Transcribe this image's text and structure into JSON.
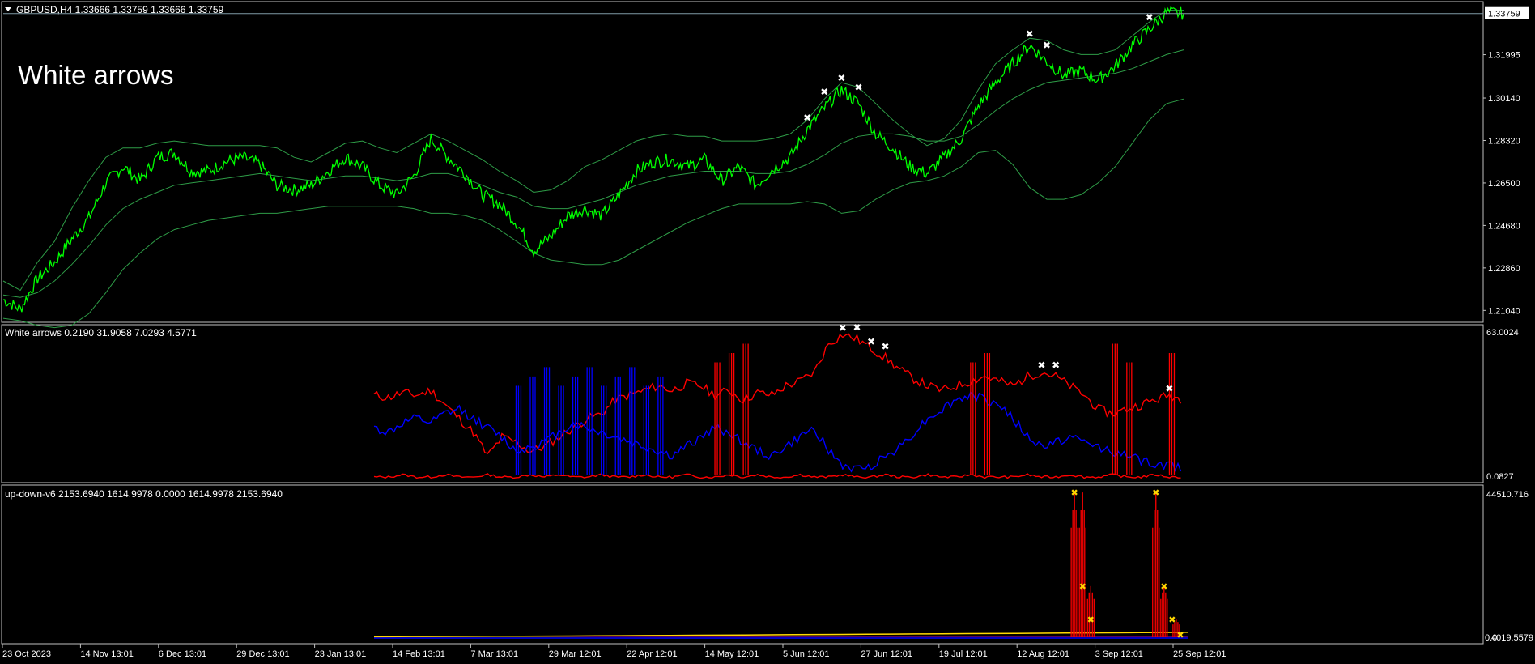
{
  "colors": {
    "background": "#000000",
    "frame": "#c0c0c0",
    "price_line": "#00ff00",
    "bands": "#2e9c47",
    "hline": "#7f9aa6",
    "red": "#ff0000",
    "blue": "#0000ff",
    "yellow": "#ffd700",
    "white": "#ffffff"
  },
  "header": {
    "symbol_line": "GBPUSD,H4  1.33666 1.33759 1.33666 1.33759",
    "dropdown_icon": "triangle-down-icon"
  },
  "overlay_label": "White arrows",
  "chart_data": [
    {
      "type": "line",
      "panel": "main",
      "series": [
        {
          "name": "price",
          "values": [
            1.215,
            1.211,
            1.224,
            1.231,
            1.241,
            1.25,
            1.265,
            1.272,
            1.266,
            1.276,
            1.278,
            1.27,
            1.27,
            1.274,
            1.276,
            1.273,
            1.264,
            1.262,
            1.264,
            1.27,
            1.276,
            1.272,
            1.264,
            1.26,
            1.268,
            1.284,
            1.276,
            1.269,
            1.26,
            1.256,
            1.248,
            1.236,
            1.242,
            1.251,
            1.254,
            1.251,
            1.26,
            1.27,
            1.274,
            1.275,
            1.272,
            1.275,
            1.266,
            1.272,
            1.264,
            1.271,
            1.276,
            1.288,
            1.297,
            1.305,
            1.299,
            1.286,
            1.28,
            1.272,
            1.269,
            1.276,
            1.284,
            1.298,
            1.308,
            1.316,
            1.324,
            1.317,
            1.311,
            1.313,
            1.309,
            1.315,
            1.324,
            1.331,
            1.338,
            1.3376
          ]
        },
        {
          "name": "upper",
          "values": [
            1.223,
            1.219,
            1.231,
            1.24,
            1.254,
            1.266,
            1.276,
            1.28,
            1.28,
            1.282,
            1.283,
            1.282,
            1.281,
            1.281,
            1.281,
            1.281,
            1.28,
            1.276,
            1.274,
            1.278,
            1.282,
            1.283,
            1.28,
            1.278,
            1.282,
            1.286,
            1.283,
            1.279,
            1.275,
            1.27,
            1.266,
            1.261,
            1.262,
            1.266,
            1.272,
            1.275,
            1.279,
            1.283,
            1.285,
            1.286,
            1.285,
            1.285,
            1.283,
            1.283,
            1.283,
            1.284,
            1.286,
            1.292,
            1.301,
            1.308,
            1.306,
            1.299,
            1.292,
            1.286,
            1.281,
            1.284,
            1.292,
            1.305,
            1.316,
            1.322,
            1.327,
            1.326,
            1.322,
            1.32,
            1.32,
            1.322,
            1.328,
            1.334,
            1.339,
            1.339
          ]
        },
        {
          "name": "middle",
          "values": [
            1.217,
            1.216,
            1.218,
            1.223,
            1.23,
            1.238,
            1.247,
            1.254,
            1.258,
            1.261,
            1.264,
            1.265,
            1.266,
            1.267,
            1.268,
            1.269,
            1.268,
            1.267,
            1.266,
            1.267,
            1.268,
            1.268,
            1.267,
            1.266,
            1.267,
            1.269,
            1.269,
            1.267,
            1.264,
            1.261,
            1.259,
            1.255,
            1.254,
            1.254,
            1.256,
            1.258,
            1.261,
            1.264,
            1.266,
            1.268,
            1.269,
            1.27,
            1.27,
            1.27,
            1.269,
            1.269,
            1.27,
            1.273,
            1.277,
            1.282,
            1.285,
            1.286,
            1.286,
            1.285,
            1.283,
            1.283,
            1.285,
            1.29,
            1.296,
            1.301,
            1.305,
            1.308,
            1.309,
            1.31,
            1.311,
            1.312,
            1.314,
            1.317,
            1.32,
            1.322
          ]
        },
        {
          "name": "lower",
          "values": [
            1.207,
            1.206,
            1.204,
            1.203,
            1.204,
            1.209,
            1.218,
            1.228,
            1.235,
            1.241,
            1.245,
            1.247,
            1.249,
            1.25,
            1.251,
            1.252,
            1.252,
            1.253,
            1.254,
            1.255,
            1.255,
            1.255,
            1.255,
            1.255,
            1.254,
            1.252,
            1.252,
            1.251,
            1.249,
            1.245,
            1.24,
            1.235,
            1.232,
            1.231,
            1.23,
            1.23,
            1.232,
            1.236,
            1.24,
            1.244,
            1.248,
            1.251,
            1.254,
            1.256,
            1.256,
            1.256,
            1.256,
            1.257,
            1.256,
            1.252,
            1.253,
            1.258,
            1.262,
            1.265,
            1.266,
            1.268,
            1.272,
            1.278,
            1.279,
            1.273,
            1.263,
            1.258,
            1.258,
            1.26,
            1.265,
            1.272,
            1.282,
            1.292,
            1.299,
            1.301
          ]
        }
      ],
      "ylim": [
        1.206,
        1.342
      ],
      "y_ticks": [
        "1.33759",
        "1.31995",
        "1.30140",
        "1.28320",
        "1.26500",
        "1.24680",
        "1.22860",
        "1.21040"
      ],
      "current_price": "1.33759",
      "x_ticks": [
        "23 Oct 2023",
        "14 Nov 13:01",
        "6 Dec 13:01",
        "29 Dec 13:01",
        "23 Jan 13:01",
        "14 Feb 13:01",
        "7 Mar 13:01",
        "29 Mar 12:01",
        "22 Apr 12:01",
        "14 May 12:01",
        "5 Jun 12:01",
        "27 Jun 12:01",
        "19 Jul 12:01",
        "12 Aug 12:01",
        "3 Sep 12:01",
        "25 Sep 12:01"
      ],
      "markers": [
        47,
        48,
        49,
        50,
        60,
        61,
        67,
        68
      ]
    },
    {
      "type": "line",
      "panel": "indicator1",
      "title": "White arrows 0.2190 31.9058 7.0293 4.5771",
      "y_ticks": [
        "63.0024",
        "0.0827"
      ],
      "ylim": [
        0,
        63.0024
      ],
      "series": [
        {
          "name": "red",
          "values": [
            36,
            35,
            37,
            36,
            38,
            32,
            26,
            20,
            10,
            18,
            16,
            12,
            14,
            18,
            22,
            26,
            28,
            34,
            36,
            38,
            40,
            38,
            41,
            40,
            36,
            38,
            34,
            37,
            36,
            40,
            42,
            46,
            58,
            62,
            60,
            56,
            52,
            47,
            43,
            40,
            38,
            40,
            42,
            44,
            42,
            40,
            44,
            46,
            44,
            40,
            36,
            30,
            28,
            30,
            32,
            34,
            36,
            34
          ]
        },
        {
          "name": "blue",
          "values": [
            22,
            20,
            24,
            26,
            24,
            28,
            30,
            26,
            22,
            18,
            12,
            14,
            16,
            20,
            24,
            22,
            20,
            18,
            16,
            14,
            12,
            10,
            14,
            18,
            22,
            20,
            16,
            12,
            10,
            14,
            18,
            22,
            12,
            6,
            4,
            6,
            10,
            14,
            20,
            26,
            30,
            34,
            36,
            34,
            32,
            26,
            18,
            14,
            16,
            18,
            16,
            14,
            12,
            10,
            8,
            6,
            6,
            5
          ]
        },
        {
          "name": "flat",
          "values": [
            1,
            1,
            2,
            1,
            1,
            2,
            1,
            1,
            2,
            1,
            1,
            2,
            1,
            2,
            1,
            1,
            2,
            1,
            1,
            2,
            1,
            1,
            2,
            1,
            1,
            2,
            1,
            2,
            1,
            1,
            2,
            1,
            1,
            2,
            1,
            1,
            2,
            1,
            1,
            2,
            1,
            1,
            2,
            1,
            1,
            1,
            2,
            1,
            1,
            2,
            1,
            1,
            2,
            1,
            1,
            2,
            1,
            1
          ]
        }
      ],
      "spikes": [
        {
          "color": "blue",
          "positions": [
            10,
            11,
            12,
            13,
            14,
            15,
            16,
            17,
            18,
            19,
            20
          ]
        },
        {
          "color": "red",
          "positions": [
            24,
            25,
            26,
            42,
            43,
            52,
            53,
            56
          ]
        }
      ],
      "markers": [
        33,
        34,
        35,
        36,
        47,
        48,
        56
      ]
    },
    {
      "type": "line",
      "panel": "indicator2",
      "title": "up-down-v6 2153.6940 1614.9978 0.0000 1614.9978 2153.6940",
      "y_ticks": [
        "44510.716",
        "0.0",
        "4019.5579"
      ],
      "ylim": [
        0,
        44510.716
      ],
      "series": [
        {
          "name": "yellow",
          "values": [
            400,
            420,
            430,
            440,
            450,
            460,
            470,
            480,
            500,
            520,
            540,
            560,
            580,
            600,
            620,
            640,
            660,
            680,
            700,
            720,
            740,
            760,
            780,
            800,
            820,
            840,
            860,
            880,
            900,
            920,
            940,
            960,
            980,
            1000
          ]
        }
      ],
      "spikes": [
        {
          "color": "red",
          "positions": [
            {
              "x": 0.86,
              "v": 44000
            },
            {
              "x": 0.87,
              "v": 44000
            },
            {
              "x": 0.88,
              "v": 16000
            },
            {
              "x": 0.96,
              "v": 44000
            },
            {
              "x": 0.97,
              "v": 16000
            },
            {
              "x": 0.985,
              "v": 6000
            }
          ]
        }
      ],
      "markers": [
        {
          "x": 0.86,
          "v": 44000
        },
        {
          "x": 0.87,
          "v": 16000
        },
        {
          "x": 0.88,
          "v": 6000
        },
        {
          "x": 0.96,
          "v": 44000
        },
        {
          "x": 0.97,
          "v": 16000
        },
        {
          "x": 0.98,
          "v": 6000
        },
        {
          "x": 0.99,
          "v": 1500
        }
      ]
    }
  ]
}
